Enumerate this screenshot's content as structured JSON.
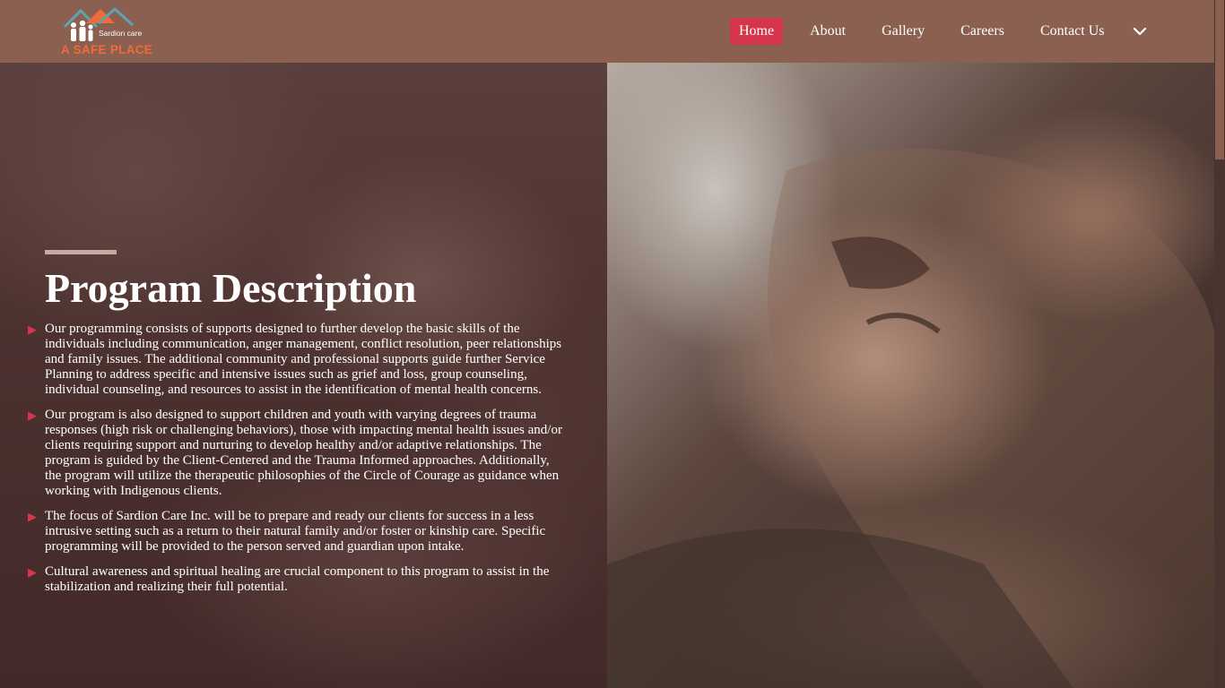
{
  "brand": {
    "logo_name": "A SAFE PLACE",
    "logo_sub": "Sardion care"
  },
  "nav": {
    "items": [
      {
        "label": "Home",
        "active": true
      },
      {
        "label": "About",
        "active": false
      },
      {
        "label": "Gallery",
        "active": false
      },
      {
        "label": "Careers",
        "active": false
      },
      {
        "label": "Contact Us",
        "active": false
      }
    ],
    "more_icon": "chevron-down-icon"
  },
  "section": {
    "title": "Program Description",
    "bullets": [
      "Our programming consists of supports designed to further develop the basic skills of the individuals including communication, anger management, conflict resolution, peer relationships and family issues. The additional community and professional supports guide further Service Planning to address specific and intensive issues such as grief and loss, group counseling, individual counseling, and resources to assist in the identification of mental health concerns.",
      "Our program is also designed to support children and youth with varying degrees of trauma responses (high risk or challenging behaviors), those with impacting mental health issues and/or clients requiring support and nurturing to develop healthy and/or adaptive relationships. The program is guided by the Client-Centered and the Trauma Informed approaches. Additionally, the program will utilize the therapeutic philosophies of the Circle of Courage as guidance when working with Indigenous clients.",
      "The focus of Sardion Care Inc. will be to prepare and ready our clients for success in a less intrusive setting such as a return to their natural family and/or foster or kinship care. Specific programming will be provided to the person served and guardian upon intake.",
      "Cultural awareness and spiritual healing are crucial component to this program to assist in the stabilization and realizing their full potential."
    ],
    "bullet_icon": "triangle-right-icon"
  },
  "colors": {
    "header_bg": "#8b6050",
    "accent": "#d6364b",
    "logo_orange": "#f06a3a"
  }
}
